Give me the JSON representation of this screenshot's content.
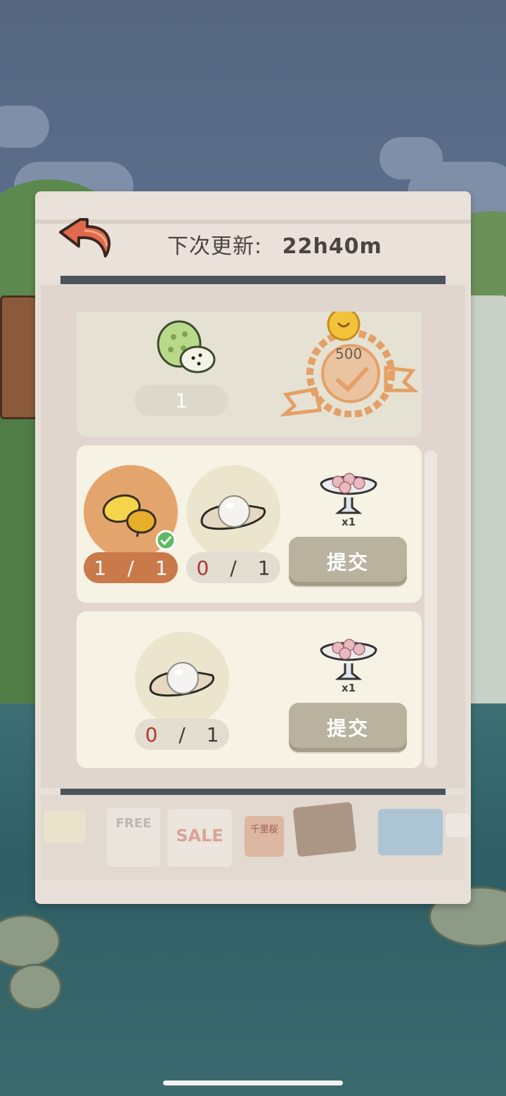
{
  "header": {
    "title_label": "下次更新:",
    "countdown": "22h40m"
  },
  "top_card": {
    "item_name": "soursop",
    "quantity": "1",
    "reward_coins": "500"
  },
  "requests": [
    {
      "items": [
        {
          "name": "lemon",
          "have": "1",
          "need": "1",
          "completed": true
        },
        {
          "name": "pearl",
          "have": "0",
          "need": "1",
          "completed": false
        }
      ],
      "reward": {
        "name": "sakura-mochi-bowl",
        "qty": "x1"
      },
      "submit_label": "提交"
    },
    {
      "items": [
        {
          "name": "pearl",
          "have": "0",
          "need": "1",
          "completed": false
        }
      ],
      "reward": {
        "name": "sakura-mochi-bowl",
        "qty": "x1"
      },
      "submit_label": "提交"
    }
  ],
  "count_separator": "/",
  "posters": [
    "FREE",
    "SALE",
    "千里桜"
  ],
  "colors": {
    "accent_orange": "#c9794a",
    "completed_circle": "#e4a56d",
    "missing_red": "#b0382f",
    "submit_button": "#b9b29f"
  }
}
